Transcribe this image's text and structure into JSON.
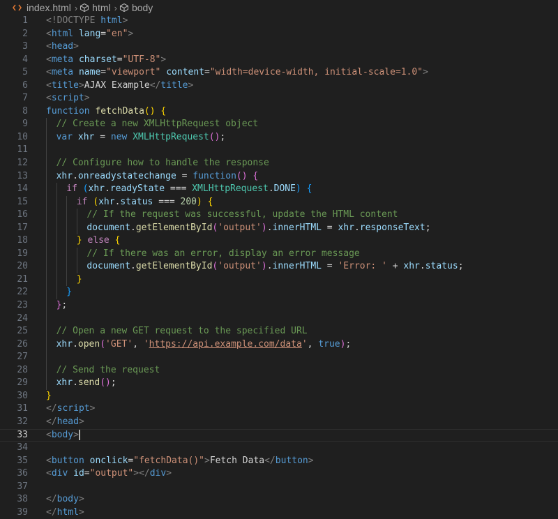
{
  "breadcrumb": {
    "file": "index.html",
    "items": [
      "html",
      "body"
    ]
  },
  "editor": {
    "current_line": 33,
    "lines": [
      {
        "n": "1",
        "indent": 0,
        "tokens": [
          [
            "tag",
            "<!DOCTYPE "
          ],
          [
            "tname",
            "html"
          ],
          [
            "tag",
            ">"
          ]
        ]
      },
      {
        "n": "2",
        "indent": 0,
        "tokens": [
          [
            "tag",
            "<"
          ],
          [
            "tname",
            "html"
          ],
          [
            "txt",
            " "
          ],
          [
            "attr",
            "lang"
          ],
          [
            "txt",
            "="
          ],
          [
            "str",
            "\"en\""
          ],
          [
            "tag",
            ">"
          ]
        ]
      },
      {
        "n": "3",
        "indent": 0,
        "tokens": [
          [
            "tag",
            "<"
          ],
          [
            "tname",
            "head"
          ],
          [
            "tag",
            ">"
          ]
        ]
      },
      {
        "n": "4",
        "indent": 0,
        "tokens": [
          [
            "tag",
            "<"
          ],
          [
            "tname",
            "meta"
          ],
          [
            "txt",
            " "
          ],
          [
            "attr",
            "charset"
          ],
          [
            "txt",
            "="
          ],
          [
            "str",
            "\"UTF-8\""
          ],
          [
            "tag",
            ">"
          ]
        ]
      },
      {
        "n": "5",
        "indent": 0,
        "tokens": [
          [
            "tag",
            "<"
          ],
          [
            "tname",
            "meta"
          ],
          [
            "txt",
            " "
          ],
          [
            "attr",
            "name"
          ],
          [
            "txt",
            "="
          ],
          [
            "str",
            "\"viewport\""
          ],
          [
            "txt",
            " "
          ],
          [
            "attr",
            "content"
          ],
          [
            "txt",
            "="
          ],
          [
            "str",
            "\"width=device-width, initial-scale=1.0\""
          ],
          [
            "tag",
            ">"
          ]
        ]
      },
      {
        "n": "6",
        "indent": 0,
        "tokens": [
          [
            "tag",
            "<"
          ],
          [
            "tname",
            "title"
          ],
          [
            "tag",
            ">"
          ],
          [
            "txt",
            "AJAX Example"
          ],
          [
            "tag",
            "</"
          ],
          [
            "tname",
            "title"
          ],
          [
            "tag",
            ">"
          ]
        ]
      },
      {
        "n": "7",
        "indent": 0,
        "tokens": [
          [
            "tag",
            "<"
          ],
          [
            "tname",
            "script"
          ],
          [
            "tag",
            ">"
          ]
        ]
      },
      {
        "n": "8",
        "indent": 0,
        "tokens": [
          [
            "kw",
            "function"
          ],
          [
            "txt",
            " "
          ],
          [
            "fn",
            "fetchData"
          ],
          [
            "br1",
            "()"
          ],
          [
            "txt",
            " "
          ],
          [
            "br1",
            "{"
          ]
        ]
      },
      {
        "n": "9",
        "indent": 1,
        "tokens": [
          [
            "com",
            "// Create a new XMLHttpRequest object"
          ]
        ]
      },
      {
        "n": "10",
        "indent": 1,
        "tokens": [
          [
            "kw",
            "var"
          ],
          [
            "txt",
            " "
          ],
          [
            "var",
            "xhr"
          ],
          [
            "txt",
            " = "
          ],
          [
            "kw",
            "new"
          ],
          [
            "txt",
            " "
          ],
          [
            "cls",
            "XMLHttpRequest"
          ],
          [
            "br2",
            "()"
          ],
          [
            "txt",
            ";"
          ]
        ]
      },
      {
        "n": "11",
        "indent": 1,
        "tokens": []
      },
      {
        "n": "12",
        "indent": 1,
        "tokens": [
          [
            "com",
            "// Configure how to handle the response"
          ]
        ]
      },
      {
        "n": "13",
        "indent": 1,
        "tokens": [
          [
            "var",
            "xhr"
          ],
          [
            "txt",
            "."
          ],
          [
            "var",
            "onreadystatechange"
          ],
          [
            "txt",
            " = "
          ],
          [
            "kw",
            "function"
          ],
          [
            "br2",
            "()"
          ],
          [
            "txt",
            " "
          ],
          [
            "br2",
            "{"
          ]
        ]
      },
      {
        "n": "14",
        "indent": 2,
        "tokens": [
          [
            "ctl",
            "if"
          ],
          [
            "txt",
            " "
          ],
          [
            "br3",
            "("
          ],
          [
            "var",
            "xhr"
          ],
          [
            "txt",
            "."
          ],
          [
            "var",
            "readyState"
          ],
          [
            "txt",
            " === "
          ],
          [
            "cls",
            "XMLHttpRequest"
          ],
          [
            "txt",
            "."
          ],
          [
            "var",
            "DONE"
          ],
          [
            "br3",
            ")"
          ],
          [
            "txt",
            " "
          ],
          [
            "br3",
            "{"
          ]
        ]
      },
      {
        "n": "15",
        "indent": 3,
        "tokens": [
          [
            "ctl",
            "if"
          ],
          [
            "txt",
            " "
          ],
          [
            "br1",
            "("
          ],
          [
            "var",
            "xhr"
          ],
          [
            "txt",
            "."
          ],
          [
            "var",
            "status"
          ],
          [
            "txt",
            " === "
          ],
          [
            "num",
            "200"
          ],
          [
            "br1",
            ")"
          ],
          [
            "txt",
            " "
          ],
          [
            "br1",
            "{"
          ]
        ]
      },
      {
        "n": "16",
        "indent": 4,
        "tokens": [
          [
            "com",
            "// If the request was successful, update the HTML content"
          ]
        ]
      },
      {
        "n": "17",
        "indent": 4,
        "tokens": [
          [
            "var",
            "document"
          ],
          [
            "txt",
            "."
          ],
          [
            "fn",
            "getElementById"
          ],
          [
            "br2",
            "("
          ],
          [
            "str",
            "'output'"
          ],
          [
            "br2",
            ")"
          ],
          [
            "txt",
            "."
          ],
          [
            "var",
            "innerHTML"
          ],
          [
            "txt",
            " = "
          ],
          [
            "var",
            "xhr"
          ],
          [
            "txt",
            "."
          ],
          [
            "var",
            "responseText"
          ],
          [
            "txt",
            ";"
          ]
        ]
      },
      {
        "n": "18",
        "indent": 3,
        "tokens": [
          [
            "br1",
            "}"
          ],
          [
            "txt",
            " "
          ],
          [
            "ctl",
            "else"
          ],
          [
            "txt",
            " "
          ],
          [
            "br1",
            "{"
          ]
        ]
      },
      {
        "n": "19",
        "indent": 4,
        "tokens": [
          [
            "com",
            "// If there was an error, display an error message"
          ]
        ]
      },
      {
        "n": "20",
        "indent": 4,
        "tokens": [
          [
            "var",
            "document"
          ],
          [
            "txt",
            "."
          ],
          [
            "fn",
            "getElementById"
          ],
          [
            "br2",
            "("
          ],
          [
            "str",
            "'output'"
          ],
          [
            "br2",
            ")"
          ],
          [
            "txt",
            "."
          ],
          [
            "var",
            "innerHTML"
          ],
          [
            "txt",
            " = "
          ],
          [
            "str",
            "'Error: '"
          ],
          [
            "txt",
            " + "
          ],
          [
            "var",
            "xhr"
          ],
          [
            "txt",
            "."
          ],
          [
            "var",
            "status"
          ],
          [
            "txt",
            ";"
          ]
        ]
      },
      {
        "n": "21",
        "indent": 3,
        "tokens": [
          [
            "br1",
            "}"
          ]
        ]
      },
      {
        "n": "22",
        "indent": 2,
        "tokens": [
          [
            "br3",
            "}"
          ]
        ]
      },
      {
        "n": "23",
        "indent": 1,
        "tokens": [
          [
            "br2",
            "}"
          ],
          [
            "txt",
            ";"
          ]
        ]
      },
      {
        "n": "24",
        "indent": 1,
        "tokens": []
      },
      {
        "n": "25",
        "indent": 1,
        "tokens": [
          [
            "com",
            "// Open a new GET request to the specified URL"
          ]
        ]
      },
      {
        "n": "26",
        "indent": 1,
        "tokens": [
          [
            "var",
            "xhr"
          ],
          [
            "txt",
            "."
          ],
          [
            "fn",
            "open"
          ],
          [
            "br2",
            "("
          ],
          [
            "str",
            "'GET'"
          ],
          [
            "txt",
            ", "
          ],
          [
            "str",
            "'"
          ],
          [
            "link",
            "https://api.example.com/data"
          ],
          [
            "str",
            "'"
          ],
          [
            "txt",
            ", "
          ],
          [
            "kw",
            "true"
          ],
          [
            "br2",
            ")"
          ],
          [
            "txt",
            ";"
          ]
        ]
      },
      {
        "n": "27",
        "indent": 1,
        "tokens": []
      },
      {
        "n": "28",
        "indent": 1,
        "tokens": [
          [
            "com",
            "// Send the request"
          ]
        ]
      },
      {
        "n": "29",
        "indent": 1,
        "tokens": [
          [
            "var",
            "xhr"
          ],
          [
            "txt",
            "."
          ],
          [
            "fn",
            "send"
          ],
          [
            "br2",
            "()"
          ],
          [
            "txt",
            ";"
          ]
        ]
      },
      {
        "n": "30",
        "indent": 0,
        "tokens": [
          [
            "br1",
            "}"
          ]
        ]
      },
      {
        "n": "31",
        "indent": 0,
        "tokens": [
          [
            "tag",
            "</"
          ],
          [
            "tname",
            "script"
          ],
          [
            "tag",
            ">"
          ]
        ]
      },
      {
        "n": "32",
        "indent": 0,
        "tokens": [
          [
            "tag",
            "</"
          ],
          [
            "tname",
            "head"
          ],
          [
            "tag",
            ">"
          ]
        ]
      },
      {
        "n": "33",
        "indent": 0,
        "tokens": [
          [
            "tag",
            "<"
          ],
          [
            "tname",
            "body"
          ],
          [
            "tag",
            ">"
          ]
        ],
        "cursor": true
      },
      {
        "n": "34",
        "indent": 0,
        "tokens": []
      },
      {
        "n": "35",
        "indent": 0,
        "tokens": [
          [
            "tag",
            "<"
          ],
          [
            "tname",
            "button"
          ],
          [
            "txt",
            " "
          ],
          [
            "attr",
            "onclick"
          ],
          [
            "txt",
            "="
          ],
          [
            "str",
            "\"fetchData()\""
          ],
          [
            "tag",
            ">"
          ],
          [
            "txt",
            "Fetch Data"
          ],
          [
            "tag",
            "</"
          ],
          [
            "tname",
            "button"
          ],
          [
            "tag",
            ">"
          ]
        ]
      },
      {
        "n": "36",
        "indent": 0,
        "tokens": [
          [
            "tag",
            "<"
          ],
          [
            "tname",
            "div"
          ],
          [
            "txt",
            " "
          ],
          [
            "attr",
            "id"
          ],
          [
            "txt",
            "="
          ],
          [
            "str",
            "\"output\""
          ],
          [
            "tag",
            "></"
          ],
          [
            "tname",
            "div"
          ],
          [
            "tag",
            ">"
          ]
        ]
      },
      {
        "n": "37",
        "indent": 0,
        "tokens": []
      },
      {
        "n": "38",
        "indent": 0,
        "tokens": [
          [
            "tag",
            "</"
          ],
          [
            "tname",
            "body"
          ],
          [
            "tag",
            ">"
          ]
        ]
      },
      {
        "n": "39",
        "indent": 0,
        "tokens": [
          [
            "tag",
            "</"
          ],
          [
            "tname",
            "html"
          ],
          [
            "tag",
            ">"
          ]
        ]
      }
    ]
  }
}
